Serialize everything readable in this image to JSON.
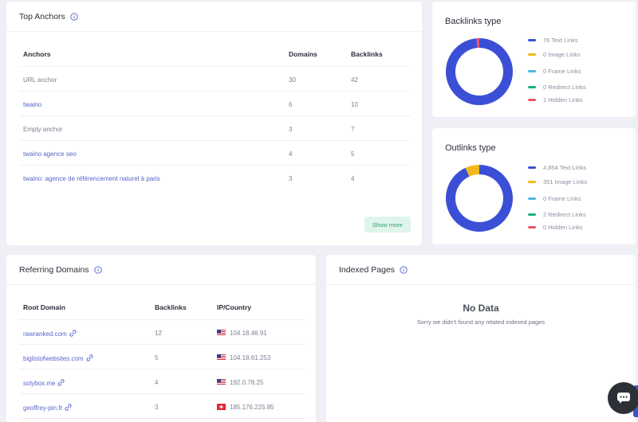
{
  "top_anchors": {
    "title": "Top Anchors",
    "columns": [
      "Anchors",
      "Domains",
      "Backlinks"
    ],
    "rows": [
      {
        "anchor": "URL anchor",
        "domains": "30",
        "backlinks": "42",
        "link": false
      },
      {
        "anchor": "twaino",
        "domains": "6",
        "backlinks": "10",
        "link": true
      },
      {
        "anchor": "Empty anchor",
        "domains": "3",
        "backlinks": "7",
        "link": false
      },
      {
        "anchor": "twaino agence seo",
        "domains": "4",
        "backlinks": "5",
        "link": true
      },
      {
        "anchor": "twaino: agence de référencement naturel à paris",
        "domains": "3",
        "backlinks": "4",
        "link": true
      }
    ],
    "show_more": "Show more"
  },
  "backlinks_type": {
    "title": "Backlinks type",
    "legend": [
      {
        "label": "76 Text Links",
        "value": 76,
        "color": "#3b4fd6"
      },
      {
        "label": "0 Image Links",
        "value": 0,
        "color": "#f5b81b"
      },
      {
        "label": "0 Frame Links",
        "value": 0,
        "color": "#4fb3e8"
      },
      {
        "label": "0 Redirect Links",
        "value": 0,
        "color": "#1cb07a"
      },
      {
        "label": "1 Hidden Links",
        "value": 1,
        "color": "#f0506e"
      }
    ]
  },
  "outlinks_type": {
    "title": "Outlinks type",
    "legend": [
      {
        "label": "4,854 Text Links",
        "value": 4854,
        "color": "#3b4fd6"
      },
      {
        "label": "351 Image Links",
        "value": 351,
        "color": "#f5b81b"
      },
      {
        "label": "0 Frame Links",
        "value": 0,
        "color": "#4fb3e8"
      },
      {
        "label": "2 Redirect Links",
        "value": 2,
        "color": "#1cb07a"
      },
      {
        "label": "0 Hidden Links",
        "value": 0,
        "color": "#f0506e"
      }
    ]
  },
  "referring_domains": {
    "title": "Referring Domains",
    "columns": [
      "Root Domain",
      "Backlinks",
      "IP/Country"
    ],
    "rows": [
      {
        "domain": "rawranked.com",
        "backlinks": "12",
        "ip": "104.18.46.91",
        "flag": "us-flag"
      },
      {
        "domain": "biglistofwebsites.com",
        "backlinks": "5",
        "ip": "104.18.61.253",
        "flag": "us-flag"
      },
      {
        "domain": "solybox.me",
        "backlinks": "4",
        "ip": "192.0.78.25",
        "flag": "us-flag"
      },
      {
        "domain": "geoffrey-pin.fr",
        "backlinks": "3",
        "ip": "185.176.225.85",
        "flag": "ch-flag"
      }
    ]
  },
  "indexed_pages": {
    "title": "Indexed Pages",
    "empty_title": "No Data",
    "empty_message": "Sorry we didn't found any related indexed pages"
  },
  "chat": {
    "icon": "chat-bubble-icon"
  }
}
